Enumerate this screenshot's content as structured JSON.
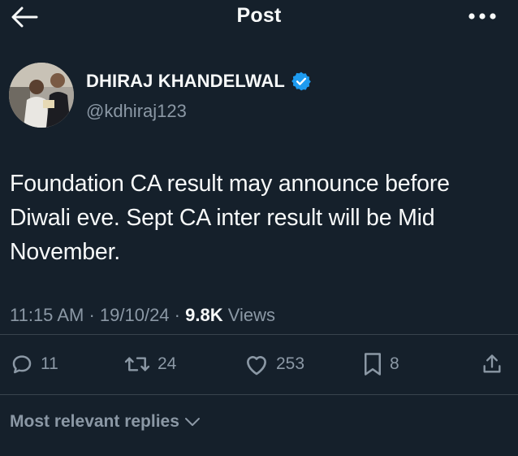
{
  "header": {
    "title": "Post",
    "back_icon": "arrow-left-icon",
    "more_icon": "more-horizontal-icon"
  },
  "author": {
    "name": "DHIRAJ KHANDELWAL",
    "handle": "@kdhiraj123",
    "verified": true,
    "verified_color": "#1d9bf0"
  },
  "post": {
    "text": "Foundation CA result may announce before Diwali eve. Sept CA inter result will be Mid November.",
    "time": "11:15 AM",
    "date": "19/10/24",
    "views_count": "9.8K",
    "views_label": "Views"
  },
  "actions": {
    "replies": "11",
    "reposts": "24",
    "likes": "253",
    "bookmarks": "8"
  },
  "replies_sort": {
    "label": "Most relevant replies"
  },
  "colors": {
    "background": "#15202b",
    "text_primary": "#f7f9f9",
    "text_secondary": "#8b98a5",
    "divider": "#38444d"
  }
}
